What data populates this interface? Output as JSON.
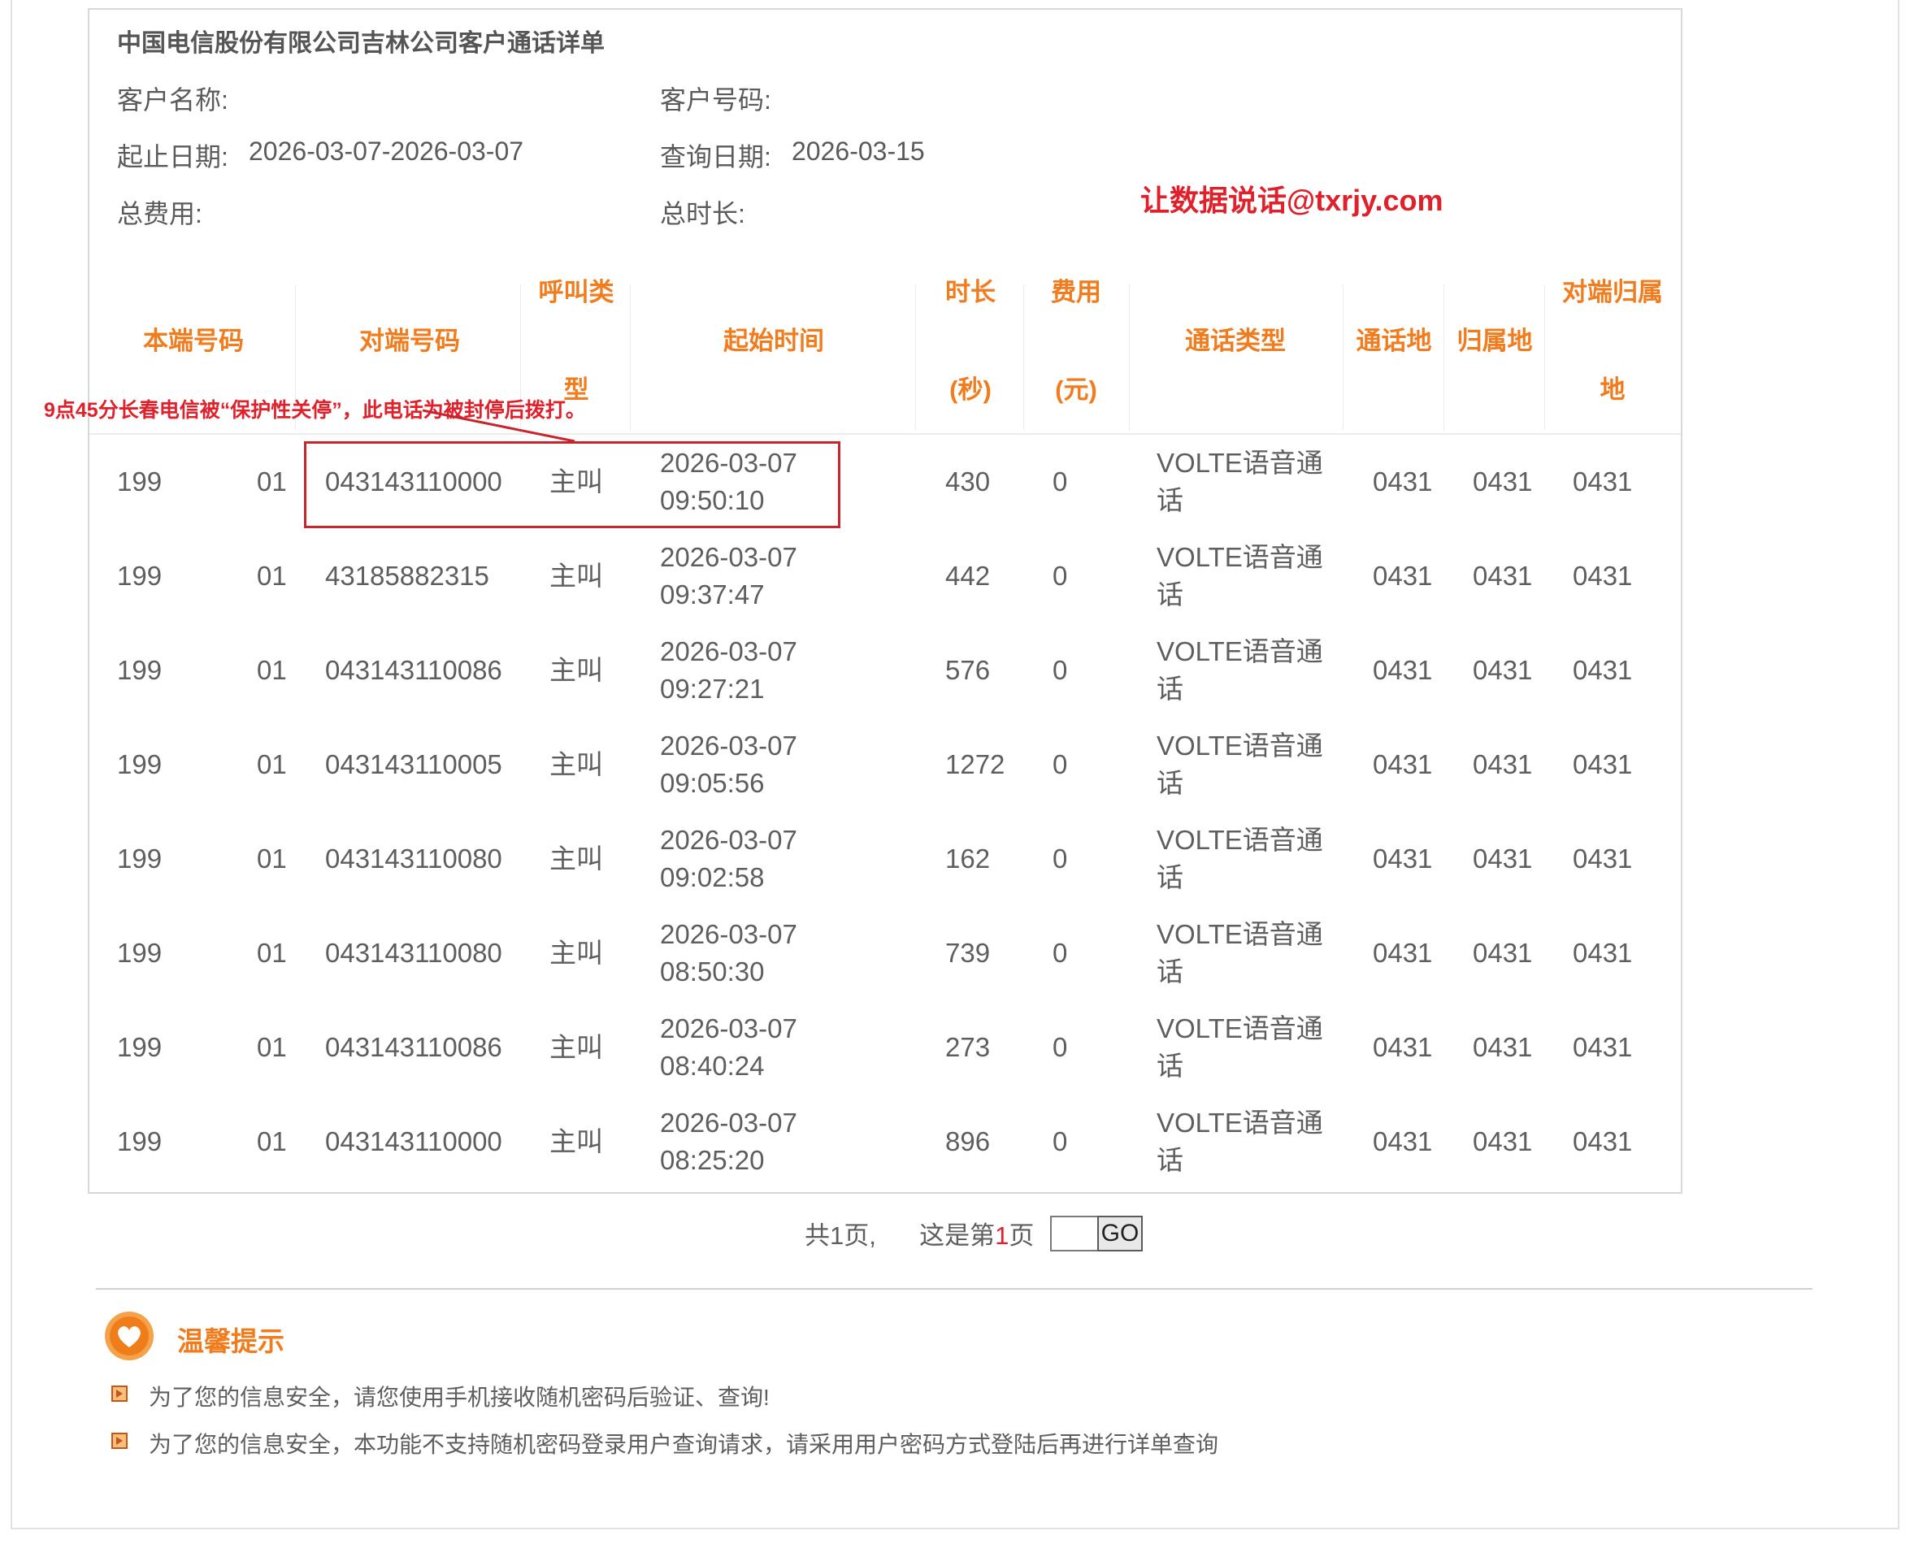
{
  "header": {
    "title": "中国电信股份有限公司吉林公司客户通话详单",
    "customer_name_label": "客户名称:",
    "customer_number_label": "客户号码:",
    "date_range_label": "起止日期:",
    "date_range_value": "2026-03-07-2026-03-07",
    "query_date_label": "查询日期:",
    "query_date_value": "2026-03-15",
    "total_fee_label": "总费用:",
    "total_duration_label": "总时长:",
    "watermark": "让数据说话@txrjy.com"
  },
  "table": {
    "columns": [
      {
        "line1": "",
        "line2": "本端号码",
        "line3": ""
      },
      {
        "line1": "",
        "line2": "对端号码",
        "line3": ""
      },
      {
        "line1": "呼叫类",
        "line2": "",
        "line3": "型"
      },
      {
        "line1": "",
        "line2": "起始时间",
        "line3": ""
      },
      {
        "line1": "时长",
        "line2": "",
        "line3": "(秒)"
      },
      {
        "line1": "费用",
        "line2": "",
        "line3": "(元)"
      },
      {
        "line1": "",
        "line2": "通话类型",
        "line3": ""
      },
      {
        "line1": "",
        "line2": "通话地",
        "line3": ""
      },
      {
        "line1": "",
        "line2": "归属地",
        "line3": ""
      },
      {
        "line1": "对端归属",
        "line2": "",
        "line3": "地"
      }
    ],
    "rows": [
      {
        "local_a": "199",
        "local_b": "01",
        "peer": "043143110000",
        "call_type": "主叫",
        "start_date": "2026-03-07",
        "start_time": "09:50:10",
        "duration": "430",
        "fee": "0",
        "type_line1": "VOLTE语音通",
        "type_line2": "话",
        "call_loc": "0431",
        "home_loc": "0431",
        "peer_home": "0431"
      },
      {
        "local_a": "199",
        "local_b": "01",
        "peer": "43185882315",
        "call_type": "主叫",
        "start_date": "2026-03-07",
        "start_time": "09:37:47",
        "duration": "442",
        "fee": "0",
        "type_line1": "VOLTE语音通",
        "type_line2": "话",
        "call_loc": "0431",
        "home_loc": "0431",
        "peer_home": "0431"
      },
      {
        "local_a": "199",
        "local_b": "01",
        "peer": "043143110086",
        "call_type": "主叫",
        "start_date": "2026-03-07",
        "start_time": "09:27:21",
        "duration": "576",
        "fee": "0",
        "type_line1": "VOLTE语音通",
        "type_line2": "话",
        "call_loc": "0431",
        "home_loc": "0431",
        "peer_home": "0431"
      },
      {
        "local_a": "199",
        "local_b": "01",
        "peer": "043143110005",
        "call_type": "主叫",
        "start_date": "2026-03-07",
        "start_time": "09:05:56",
        "duration": "1272",
        "fee": "0",
        "type_line1": "VOLTE语音通",
        "type_line2": "话",
        "call_loc": "0431",
        "home_loc": "0431",
        "peer_home": "0431"
      },
      {
        "local_a": "199",
        "local_b": "01",
        "peer": "043143110080",
        "call_type": "主叫",
        "start_date": "2026-03-07",
        "start_time": "09:02:58",
        "duration": "162",
        "fee": "0",
        "type_line1": "VOLTE语音通",
        "type_line2": "话",
        "call_loc": "0431",
        "home_loc": "0431",
        "peer_home": "0431"
      },
      {
        "local_a": "199",
        "local_b": "01",
        "peer": "043143110080",
        "call_type": "主叫",
        "start_date": "2026-03-07",
        "start_time": "08:50:30",
        "duration": "739",
        "fee": "0",
        "type_line1": "VOLTE语音通",
        "type_line2": "话",
        "call_loc": "0431",
        "home_loc": "0431",
        "peer_home": "0431"
      },
      {
        "local_a": "199",
        "local_b": "01",
        "peer": "043143110086",
        "call_type": "主叫",
        "start_date": "2026-03-07",
        "start_time": "08:40:24",
        "duration": "273",
        "fee": "0",
        "type_line1": "VOLTE语音通",
        "type_line2": "话",
        "call_loc": "0431",
        "home_loc": "0431",
        "peer_home": "0431"
      },
      {
        "local_a": "199",
        "local_b": "01",
        "peer": "043143110000",
        "call_type": "主叫",
        "start_date": "2026-03-07",
        "start_time": "08:25:20",
        "duration": "896",
        "fee": "0",
        "type_line1": "VOLTE语音通",
        "type_line2": "话",
        "call_loc": "0431",
        "home_loc": "0431",
        "peer_home": "0431"
      }
    ]
  },
  "annotation": {
    "text": "9点45分长春电信被“保护性关停”，此电话为被封停后拨打。",
    "color": "#e0202a"
  },
  "pager": {
    "total_text": "共1页,",
    "current_prefix": "这是第",
    "current_page": "1",
    "current_suffix": "页",
    "input_value": "",
    "go_label": "GO"
  },
  "tips": {
    "icon": "heart-icon",
    "title": "温馨提示",
    "items": [
      "为了您的信息安全，请您使用手机接收随机密码后验证、查询!",
      "为了您的信息安全，本功能不支持随机密码登录用户查询请求，请采用用户密码方式登陆后再进行详单查询"
    ]
  },
  "colors": {
    "accent_orange": "#f07c1e",
    "alert_red": "#e0202a",
    "text_gray": "#5e5e5e"
  }
}
